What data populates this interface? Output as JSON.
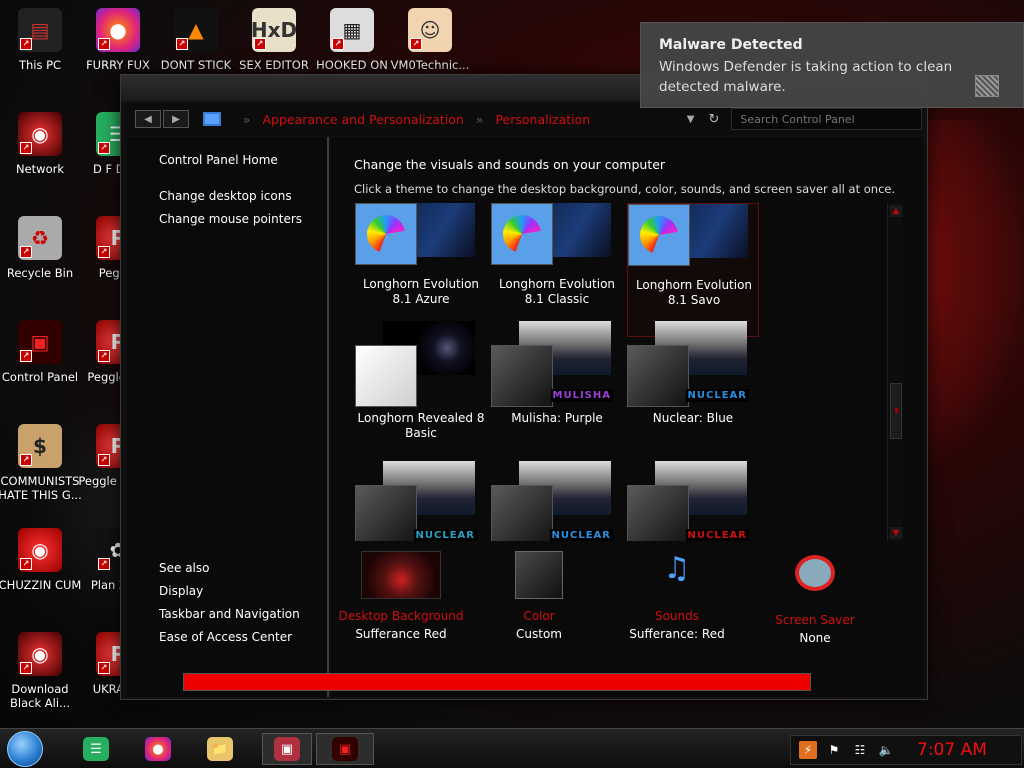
{
  "desktop": {
    "icons": [
      {
        "label": "This PC",
        "icon": "computer-icon"
      },
      {
        "label": "FURRY FUX",
        "icon": "firefox-icon"
      },
      {
        "label": "DONT STICK",
        "icon": "vlc-icon"
      },
      {
        "label": "SEX EDITOR",
        "icon": "hxd-icon"
      },
      {
        "label": "HOOKED ON",
        "icon": "app-icon"
      },
      {
        "label": "VM0Technic...",
        "icon": "doctor-icon"
      },
      {
        "label": "Network",
        "icon": "network-icon"
      },
      {
        "label": "D F DUM",
        "icon": "notes-icon"
      },
      {
        "label": "Recycle Bin",
        "icon": "recycle-bin-icon"
      },
      {
        "label": "Peggle",
        "icon": "peggle-icon"
      },
      {
        "label": "Control Panel",
        "icon": "control-panel-icon"
      },
      {
        "label": "Peggle Del",
        "icon": "peggle-icon"
      },
      {
        "label": "COMMUNISTS HATE THIS G...",
        "icon": "money-bag-icon"
      },
      {
        "label": "Peggle of War",
        "icon": "peggle-icon"
      },
      {
        "label": "CHUZZIN CUM",
        "icon": "chuzzle-icon"
      },
      {
        "label": "Plan Zom",
        "icon": "flower-icon"
      },
      {
        "label": "Download Black Ali...",
        "icon": "network-icon"
      },
      {
        "label": "UKRAINE",
        "icon": "peggle-icon"
      }
    ]
  },
  "notification": {
    "title": "Malware Detected",
    "message": "Windows Defender is taking action to clean detected malware."
  },
  "window": {
    "address": {
      "crumbs": [
        "Appearance and Personalization",
        "Personalization"
      ],
      "search_placeholder": "Search Control Panel"
    },
    "sidebar": {
      "home": "Control Panel Home",
      "links": [
        "Change desktop icons",
        "Change mouse pointers"
      ],
      "see_also_heading": "See also",
      "see_also": [
        "Display",
        "Taskbar and Navigation",
        "Ease of Access Center"
      ]
    },
    "main": {
      "title": "Change the visuals and sounds on your computer",
      "description": "Click a theme to change the desktop background, color, sounds, and screen saver all at once.",
      "themes": [
        {
          "name": "Longhorn Evolution 8.1 Azure",
          "style": "palette"
        },
        {
          "name": "Longhorn Evolution 8.1 Classic",
          "style": "palette"
        },
        {
          "name": "Longhorn Evolution 8.1 Savo",
          "style": "palette",
          "selected": true
        },
        {
          "name": "Longhorn Revealed 8 Basic",
          "style": "white"
        },
        {
          "name": "Mulisha: Purple",
          "style": "dark",
          "badge": "MULISHA",
          "badge_color": "#9b3fd6"
        },
        {
          "name": "Nuclear: Blue",
          "style": "dark",
          "badge": "NUCLEAR",
          "badge_color": "#2a8fe0"
        },
        {
          "name": "",
          "style": "dark",
          "badge": "NUCLEAR",
          "badge_color": "#2aa0c0"
        },
        {
          "name": "",
          "style": "dark",
          "badge": "NUCLEAR",
          "badge_color": "#2a8fe0"
        },
        {
          "name": "",
          "style": "dark",
          "badge": "NUCLEAR",
          "badge_color": "#d01010"
        }
      ],
      "options": [
        {
          "label": "Desktop Background",
          "value": "Sufferance Red",
          "icon": "wallpaper-icon"
        },
        {
          "label": "Color",
          "value": "Custom",
          "icon": "color-swatch-icon"
        },
        {
          "label": "Sounds",
          "value": "Sufferance: Red",
          "icon": "sounds-icon"
        },
        {
          "label": "Screen Saver",
          "value": "None",
          "icon": "screen-saver-icon"
        }
      ],
      "progress": 1.0
    }
  },
  "taskbar": {
    "apps": [
      "notes-icon",
      "firefox-icon",
      "file-explorer-icon",
      "monitor-icon",
      "control-panel-icon"
    ],
    "clock": "7:07 AM"
  },
  "colors": {
    "accent_red": "#d10f0f",
    "progress_fill": "#e00000"
  }
}
